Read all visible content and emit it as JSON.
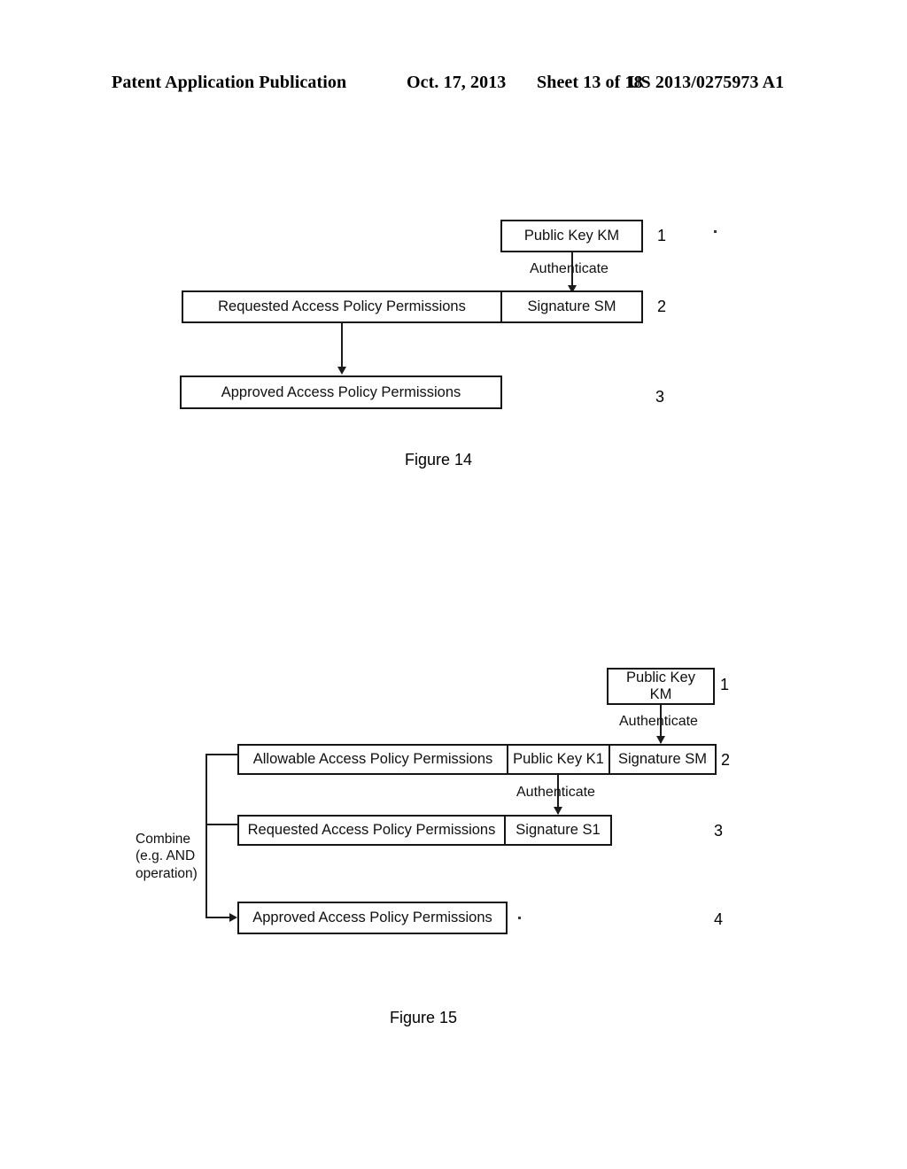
{
  "header": {
    "publication": "Patent Application Publication",
    "date": "Oct. 17, 2013",
    "sheet": "Sheet 13 of 18",
    "document_number": "US 2013/0275973 A1"
  },
  "figure14": {
    "caption": "Figure 14",
    "boxes": {
      "public_key": "Public Key KM",
      "requested": "Requested Access Policy Permissions",
      "signature": "Signature SM",
      "approved": "Approved Access Policy Permissions"
    },
    "edge_labels": {
      "authenticate": "Authenticate"
    },
    "ref_numbers": {
      "public_key": "1",
      "requested_row": "2",
      "approved": "3"
    }
  },
  "figure15": {
    "caption": "Figure 15",
    "boxes": {
      "public_key_km_line1": "Public Key",
      "public_key_km_line2": "KM",
      "allowable": "Allowable Access Policy Permissions",
      "public_key_k1": "Public Key K1",
      "signature_sm": "Signature SM",
      "requested": "Requested Access Policy Permissions",
      "signature_s1": "Signature S1",
      "approved": "Approved Access Policy Permissions"
    },
    "edge_labels": {
      "authenticate_top": "Authenticate",
      "authenticate_mid": "Authenticate"
    },
    "combine_label": {
      "line1": "Combine",
      "line2": "(e.g. AND",
      "line3": "operation)"
    },
    "ref_numbers": {
      "public_key": "1",
      "allowable_row": "2",
      "requested_row": "3",
      "approved": "4"
    }
  }
}
